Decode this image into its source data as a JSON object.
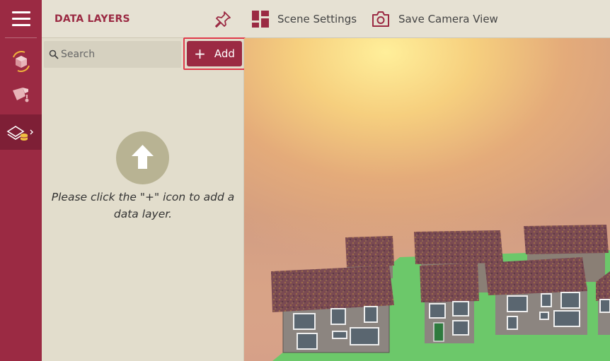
{
  "header": {
    "title": "DATA LAYERS",
    "scene_settings_label": "Scene Settings",
    "save_camera_label": "Save Camera View"
  },
  "panel": {
    "search_placeholder": "Search",
    "add_label": "Add",
    "add_plus": "+",
    "empty_message": "Please click the \"+\" icon to add a data layer."
  },
  "colors": {
    "brand": "#9b2a43",
    "panel_bg": "#e2ddcc",
    "header_bg": "#e6e1d3",
    "highlight": "#e03a4a"
  },
  "rail": {
    "items": [
      "cube-rotate-icon",
      "paint-bucket-icon",
      "layers-database-icon"
    ]
  }
}
